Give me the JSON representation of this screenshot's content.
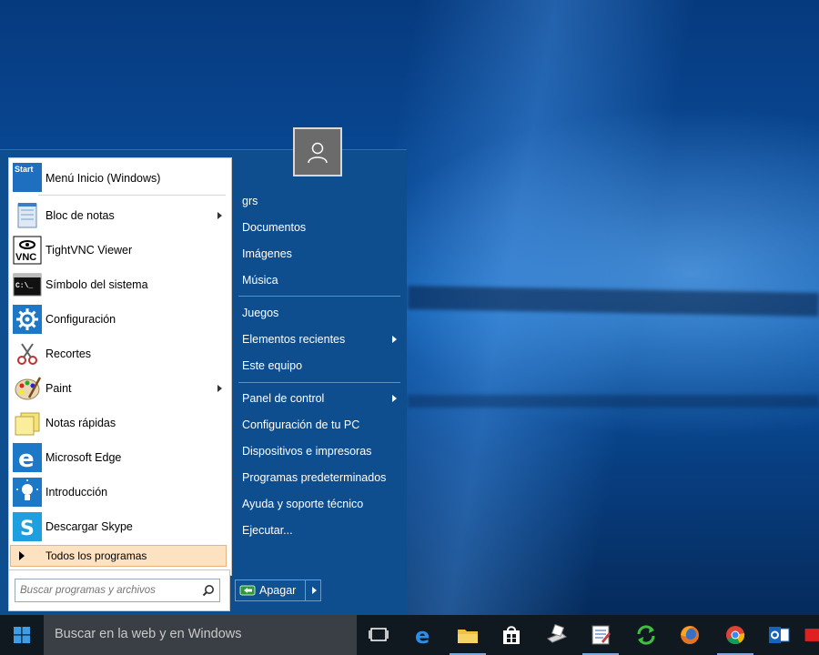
{
  "start_menu": {
    "top_item": {
      "label": "Menú Inicio (Windows)",
      "icon": "classic-start-icon",
      "icon_text": "Start"
    },
    "apps": [
      {
        "label": "Bloc de notas",
        "icon": "notepad-icon",
        "submenu": true
      },
      {
        "label": "TightVNC Viewer",
        "icon": "tightvnc-icon",
        "submenu": false
      },
      {
        "label": "Símbolo del sistema",
        "icon": "command-prompt-icon",
        "submenu": false
      },
      {
        "label": "Configuración",
        "icon": "gear-icon",
        "submenu": false
      },
      {
        "label": "Recortes",
        "icon": "snipping-tool-icon",
        "submenu": false
      },
      {
        "label": "Paint",
        "icon": "paint-icon",
        "submenu": true
      },
      {
        "label": "Notas rápidas",
        "icon": "sticky-notes-icon",
        "submenu": false
      },
      {
        "label": "Microsoft Edge",
        "icon": "edge-icon",
        "submenu": false
      },
      {
        "label": "Introducción",
        "icon": "lightbulb-icon",
        "submenu": false
      },
      {
        "label": "Descargar Skype",
        "icon": "skype-icon",
        "submenu": false
      }
    ],
    "all_programs": "Todos los programas",
    "search_placeholder": "Buscar programas y archivos",
    "right_groups": [
      [
        {
          "label": "grs",
          "submenu": false
        },
        {
          "label": "Documentos",
          "submenu": false
        },
        {
          "label": "Imágenes",
          "submenu": false
        },
        {
          "label": "Música",
          "submenu": false
        }
      ],
      [
        {
          "label": "Juegos",
          "submenu": false
        },
        {
          "label": "Elementos recientes",
          "submenu": true
        },
        {
          "label": "Este equipo",
          "submenu": false
        }
      ],
      [
        {
          "label": "Panel de control",
          "submenu": true
        },
        {
          "label": "Configuración de tu PC",
          "submenu": false
        },
        {
          "label": "Dispositivos e impresoras",
          "submenu": false
        },
        {
          "label": "Programas predeterminados",
          "submenu": false
        },
        {
          "label": "Ayuda y soporte técnico",
          "submenu": false
        },
        {
          "label": "Ejecutar...",
          "submenu": false
        }
      ]
    ],
    "shutdown_label": "Apagar"
  },
  "taskbar": {
    "search_placeholder": "Buscar en la web y en Windows",
    "icons": [
      {
        "name": "task-view-icon",
        "active": false
      },
      {
        "name": "edge-icon",
        "active": false
      },
      {
        "name": "file-explorer-icon",
        "active": true
      },
      {
        "name": "store-icon",
        "active": false
      },
      {
        "name": "scanner-icon",
        "active": false
      },
      {
        "name": "document-viewer-icon",
        "active": true
      },
      {
        "name": "sync-icon",
        "active": false
      },
      {
        "name": "firefox-icon",
        "active": false
      },
      {
        "name": "chrome-icon",
        "active": true
      },
      {
        "name": "outlook-icon",
        "active": false
      },
      {
        "name": "red-app-icon",
        "active": false
      }
    ]
  },
  "colors": {
    "menu_bg": "#0e4e8e",
    "taskbar_bg": "#101820",
    "highlight": "#fde2c2"
  }
}
